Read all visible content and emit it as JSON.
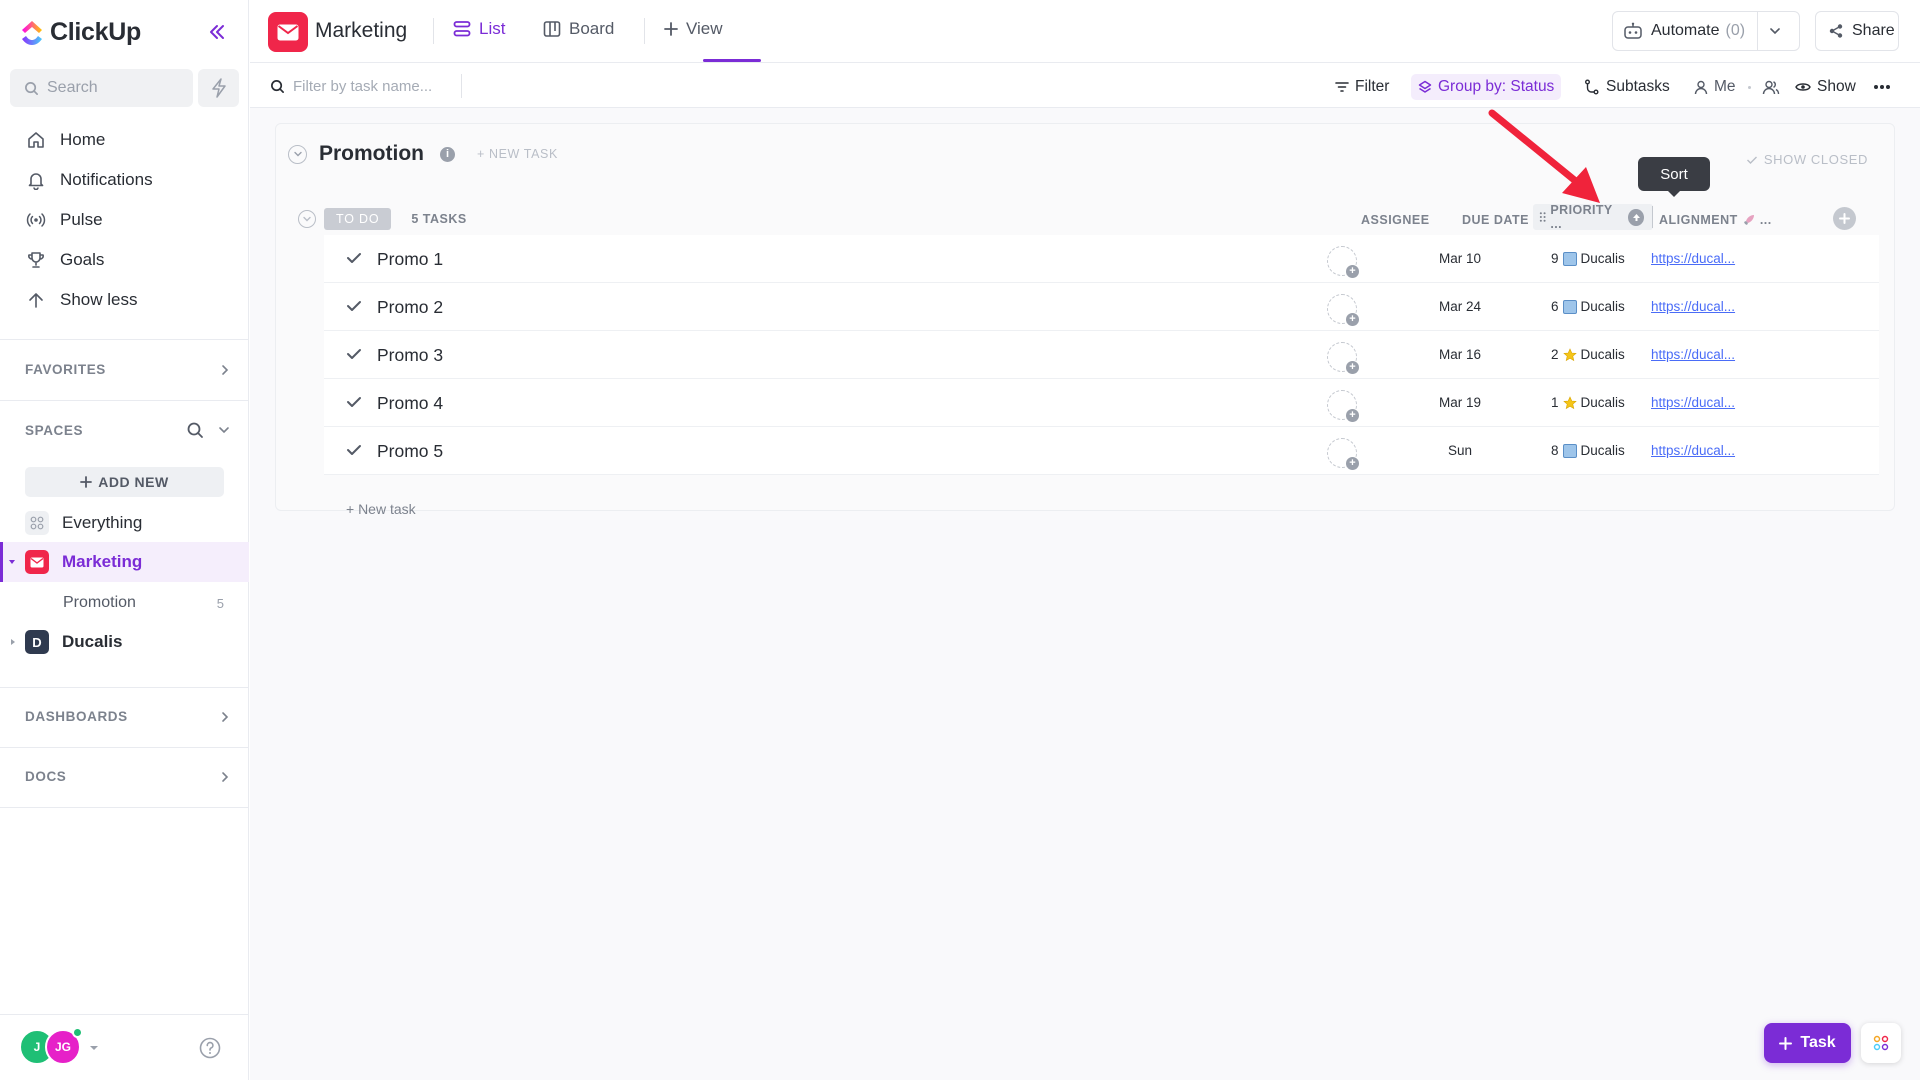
{
  "app": {
    "name": "ClickUp"
  },
  "sidebar": {
    "search_placeholder": "Search",
    "nav": [
      {
        "label": "Home",
        "icon": "home-icon"
      },
      {
        "label": "Notifications",
        "icon": "bell-icon"
      },
      {
        "label": "Pulse",
        "icon": "pulse-icon"
      },
      {
        "label": "Goals",
        "icon": "trophy-icon"
      },
      {
        "label": "Show less",
        "icon": "arrow-up-icon"
      }
    ],
    "favorites_label": "FAVORITES",
    "spaces_label": "SPACES",
    "add_new_label": "ADD NEW",
    "spaces": [
      {
        "label": "Everything"
      },
      {
        "label": "Marketing",
        "initial": "",
        "color": "#f0264a"
      },
      {
        "label": "Promotion",
        "count": "5"
      },
      {
        "label": "Ducalis",
        "initial": "D",
        "color": "#2f3a4f"
      }
    ],
    "dashboards_label": "DASHBOARDS",
    "docs_label": "DOCS",
    "user": {
      "avatar1": "J",
      "avatar2": "JG"
    }
  },
  "header": {
    "space_title": "Marketing",
    "tabs": [
      {
        "label": "List",
        "active": true
      },
      {
        "label": "Board",
        "active": false
      },
      {
        "label": "View",
        "active": false
      }
    ],
    "automate_label": "Automate",
    "automate_count": "(0)",
    "share_label": "Share"
  },
  "toolbar": {
    "filter_placeholder": "Filter by task name...",
    "filter_label": "Filter",
    "group_label": "Group by: Status",
    "subtasks_label": "Subtasks",
    "me_label": "Me",
    "show_label": "Show"
  },
  "list": {
    "title": "Promotion",
    "new_task_label": "+ NEW TASK",
    "show_closed_label": "SHOW CLOSED",
    "status": "TO DO",
    "task_count": "5 TASKS",
    "columns": {
      "assignee": "ASSIGNEE",
      "due_date": "DUE DATE",
      "priority": "PRIORITY ...",
      "alignment": "ALIGNMENT",
      "alignment_suffix": "..."
    },
    "tooltip": "Sort",
    "tasks": [
      {
        "name": "Promo 1",
        "due": "Mar 10",
        "priority": "9",
        "priority_icon": "box",
        "priority_tag": "Ducalis",
        "alignment": "https://ducal..."
      },
      {
        "name": "Promo 2",
        "due": "Mar 24",
        "priority": "6",
        "priority_icon": "box",
        "priority_tag": "Ducalis",
        "alignment": "https://ducal..."
      },
      {
        "name": "Promo 3",
        "due": "Mar 16",
        "priority": "2",
        "priority_icon": "star",
        "priority_tag": "Ducalis",
        "alignment": "https://ducal..."
      },
      {
        "name": "Promo 4",
        "due": "Mar 19",
        "priority": "1",
        "priority_icon": "star",
        "priority_tag": "Ducalis",
        "alignment": "https://ducal..."
      },
      {
        "name": "Promo 5",
        "due": "Sun",
        "priority": "8",
        "priority_icon": "box",
        "priority_tag": "Ducalis",
        "alignment": "https://ducal..."
      }
    ],
    "new_task_bottom": "+ New task"
  },
  "fab": {
    "task_label": "Task"
  },
  "colors": {
    "accent": "#7b2cd6",
    "brand_red": "#f0264a",
    "link": "#4a6cf7"
  }
}
